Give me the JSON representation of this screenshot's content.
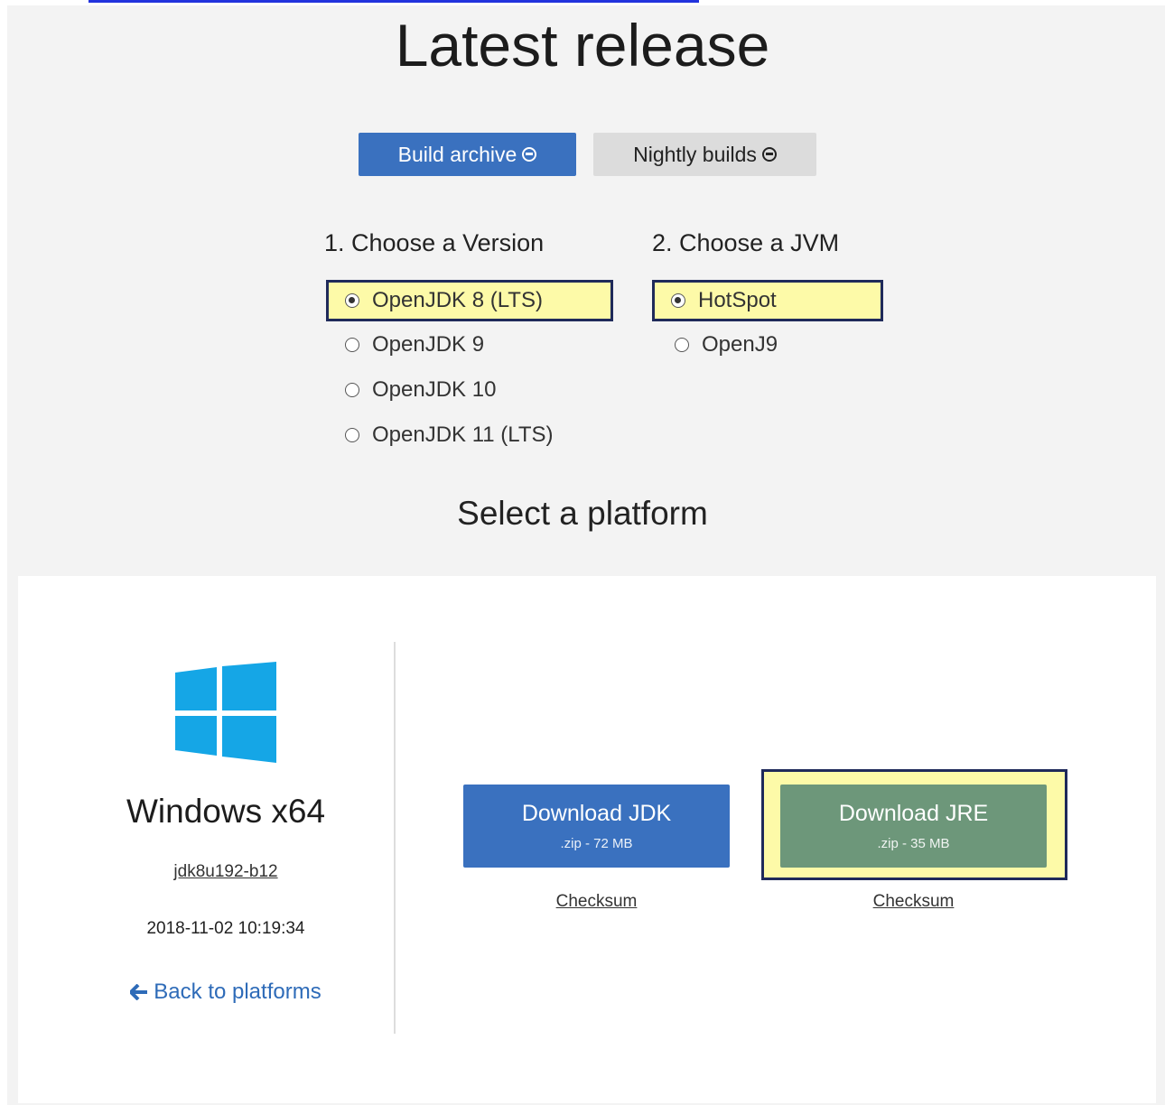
{
  "header": {
    "title": "Latest release",
    "build_archive_label": "Build archive",
    "nightly_builds_label": "Nightly builds"
  },
  "versions": {
    "heading": "1. Choose a Version",
    "options": [
      {
        "label": "OpenJDK 8 (LTS)",
        "selected": true
      },
      {
        "label": "OpenJDK 9",
        "selected": false
      },
      {
        "label": "OpenJDK 10",
        "selected": false
      },
      {
        "label": "OpenJDK 11 (LTS)",
        "selected": false
      }
    ]
  },
  "jvms": {
    "heading": "2. Choose a JVM",
    "options": [
      {
        "label": "HotSpot",
        "selected": true
      },
      {
        "label": "OpenJ9",
        "selected": false
      }
    ]
  },
  "platform_heading": "Select a platform",
  "platform": {
    "icon": "windows-logo-icon",
    "name": "Windows x64",
    "build": "jdk8u192-b12",
    "date": "2018-11-02 10:19:34",
    "back_label": "Back to platforms"
  },
  "downloads": {
    "jdk": {
      "label": "Download JDK",
      "detail": ".zip - 72 MB",
      "checksum": "Checksum"
    },
    "jre": {
      "label": "Download JRE",
      "detail": ".zip - 35 MB",
      "checksum": "Checksum"
    }
  },
  "colors": {
    "primary_blue": "#3a71bf",
    "jre_green": "#6d977a",
    "highlight_yellow": "#fdfaa8",
    "windows_blue": "#15a6e6"
  }
}
